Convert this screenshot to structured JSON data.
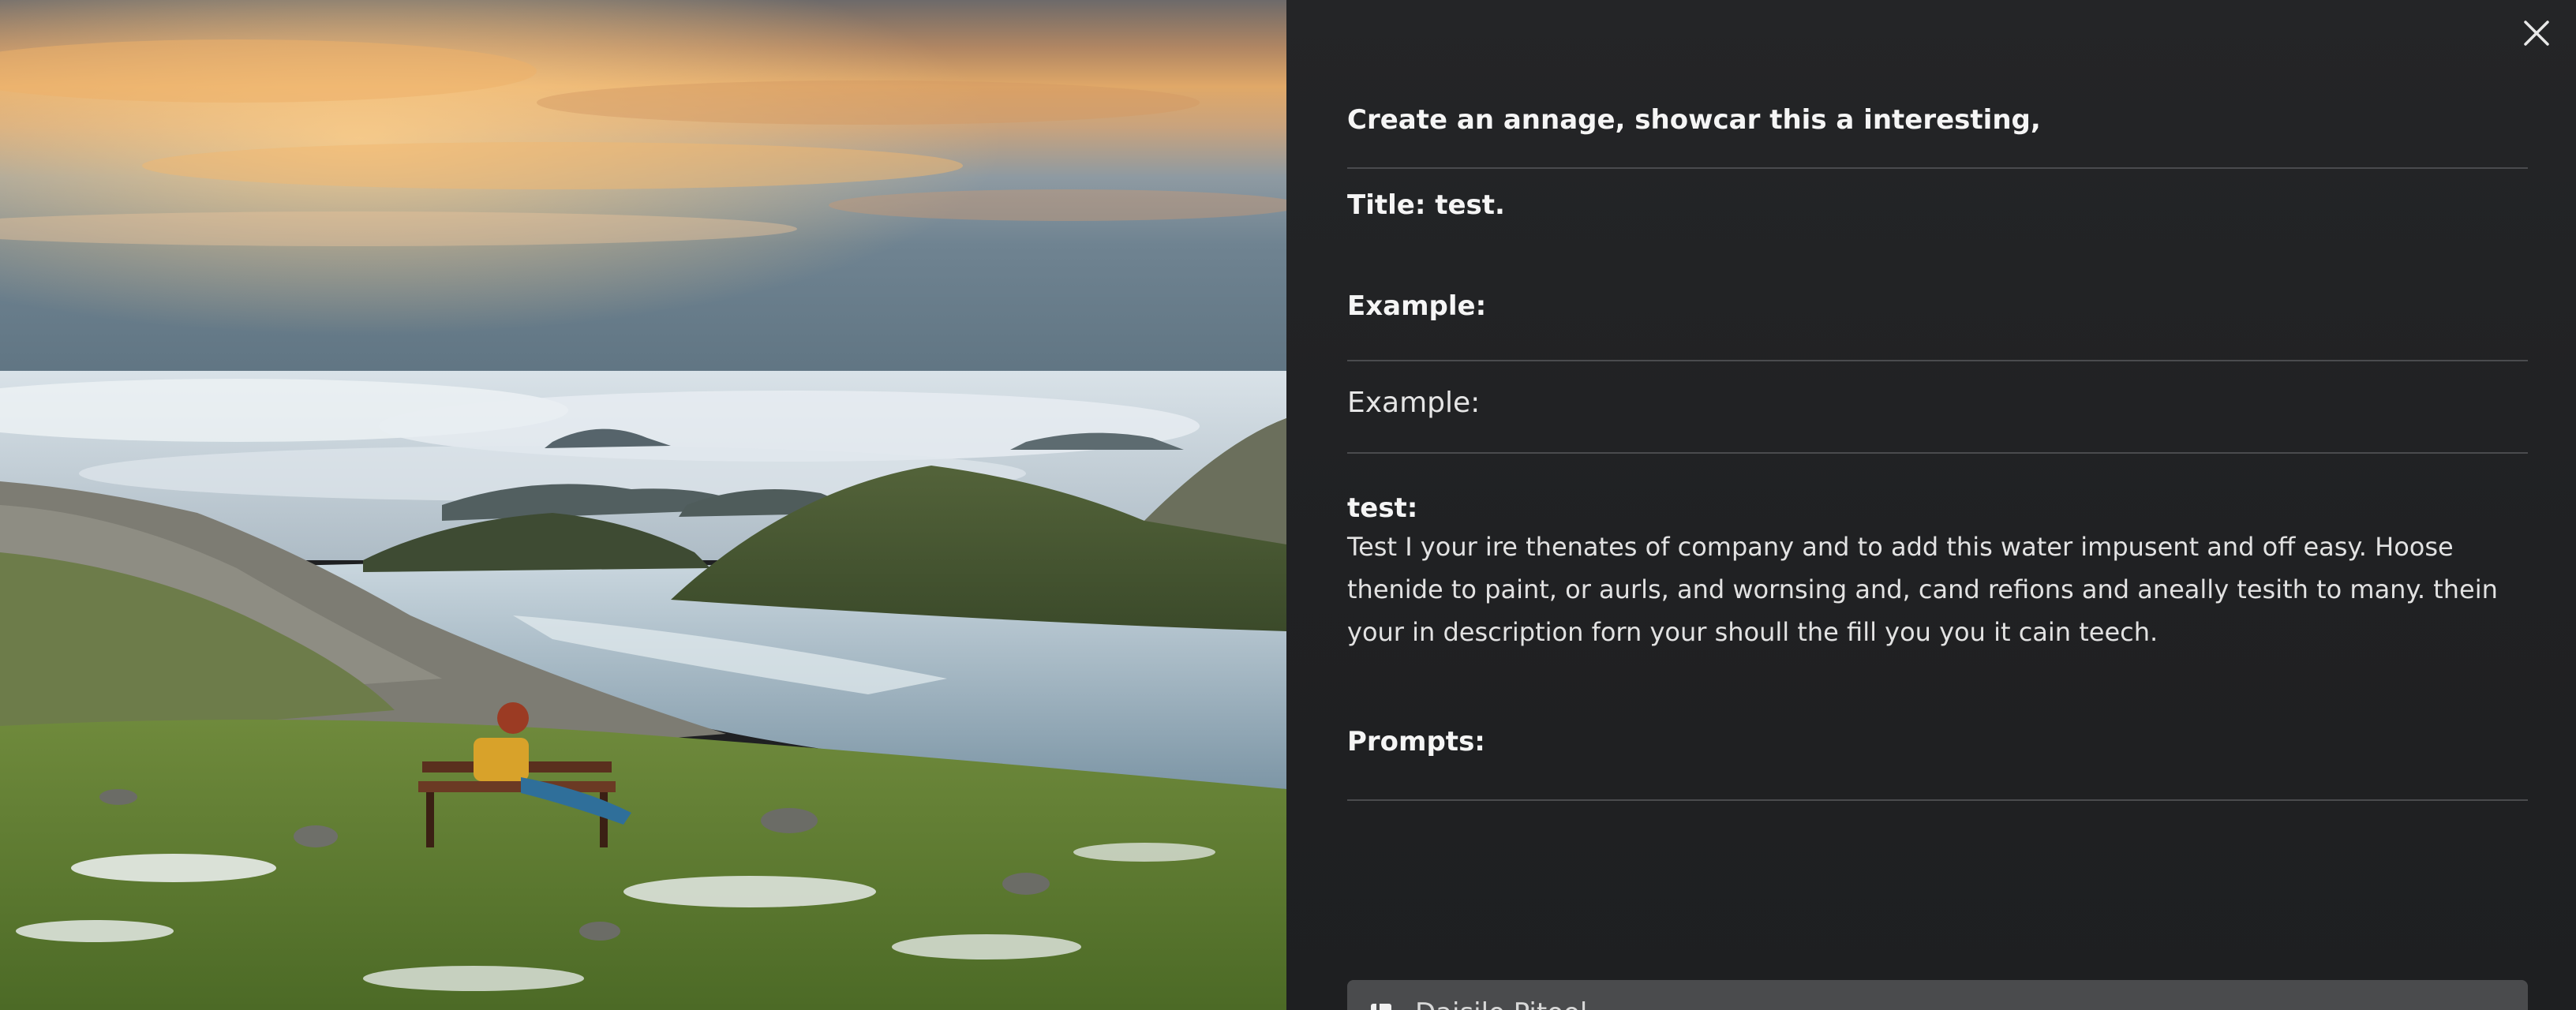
{
  "panel": {
    "heading": "Create an annage, showcar this a interesting,",
    "title_line": "Title: test.",
    "example_bold": "Example:",
    "example_regular": "Example:",
    "test_label": "test:",
    "description": "Test I your ire thenates of company and to add this water impusent and off easy. Hoose thenide to paint, or aurls, and wornsing and, cand refions and aneally tesith to many. thein your in description forn your shoull the fill you you it cain teech.",
    "prompts_label": "Prompts:",
    "bottom_button_label": "Daisilo Pitool"
  },
  "icons": {
    "close": "close-icon",
    "bottom": "square-icon"
  },
  "colors": {
    "panel_bg": "#222325",
    "divider": "#4a4b4e",
    "text": "#f1f1f1",
    "button_bg": "#4a4b4d"
  }
}
